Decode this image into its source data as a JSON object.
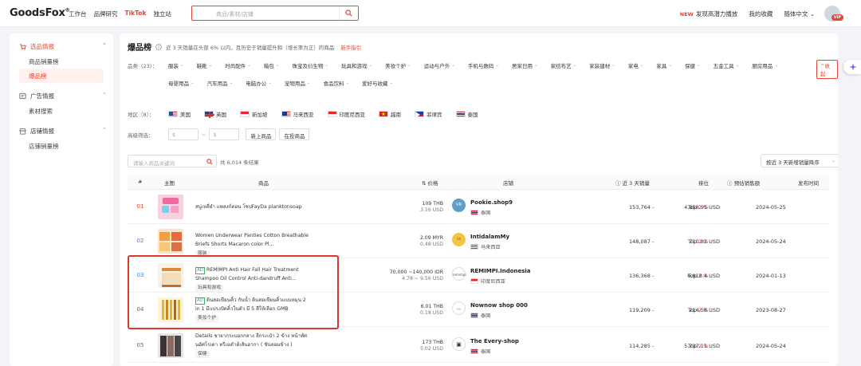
{
  "header": {
    "logo": "GoodsFox",
    "nav": [
      "工作台",
      "品牌研究",
      "TikTok",
      "独立站"
    ],
    "search_placeholder": "商品/素材/店铺",
    "new_badge": "NEW",
    "right_links": [
      "发现高潜力播放",
      "我的收藏",
      "随体中文"
    ],
    "vip": "VIP"
  },
  "sidebar": {
    "groups": [
      {
        "label": "选品情报",
        "items": [
          "商品销量榜",
          "爆品榜"
        ]
      },
      {
        "label": "广告情报",
        "items": [
          "素材搜索"
        ]
      },
      {
        "label": "店铺情报",
        "items": [
          "店铺销量榜"
        ]
      }
    ]
  },
  "main": {
    "title": "爆品榜",
    "subtitle": "近 3 天销量在头部 6% 以内，且历史于销量提升和（增长率为正）的商品",
    "guide": "新手指引",
    "category_label": "品类（23）：",
    "categories": [
      "服装",
      "鞋靴",
      "时尚配件",
      "箱包",
      "珠宝及衍生物",
      "玩具和游戏",
      "美妆个护",
      "运动与户外",
      "手机与数码",
      "居家日用",
      "家纺布艺",
      "家装建材",
      "家电",
      "家具",
      "保健",
      "五金工具",
      "厨房用品",
      "母婴用品",
      "汽车用品",
      "电脑办公",
      "宠物用品",
      "食品饮料",
      "爱好与收藏"
    ],
    "collapse_label": "^收起",
    "region_label": "地区（8）：",
    "regions": [
      "美国",
      "英国",
      "新加坡",
      "马来西亚",
      "印度尼西亚",
      "越南",
      "菲律宾",
      "泰国"
    ],
    "filter_label": "高级筛选：",
    "money_placeholder": "$",
    "money_sep": "~",
    "filter_buttons": [
      "新上商品",
      "在投商品"
    ],
    "search_placeholder": "请输入商品关键词",
    "result_count": "共 6,014 条结果",
    "sort_label": "按近 3 天新增销量降序",
    "columns": [
      "#",
      "主图",
      "商品",
      "价格",
      "店铺",
      "近 3 天销量",
      "排位",
      "预估销售额",
      "发布时间"
    ]
  },
  "rows": [
    {
      "idx": "01",
      "name": "สบู่เหลี่ยำ แพลงก์ตอน โชปFayDa planktonsoap",
      "ad": "",
      "tag": "",
      "price": "109 THB",
      "price_sub": "3.16 USD",
      "shop": "Pookie.shop9",
      "country": "泰国",
      "sales": "153,764 -",
      "rank_pre": "Top ",
      "rank_pct": "2 %",
      "rev": "4,858.95 USD",
      "date": "2024-05-25"
    },
    {
      "idx": "02",
      "name": "Women Underwear Panties Cotton Breathable Briefs Shorts Macaron color Pl...",
      "ad": "",
      "tag": "服装",
      "price": "2.09 MYR",
      "price_sub": "0.48 USD",
      "shop": "IntidalamMy",
      "country": "马来西亚",
      "sales": "148,087 -",
      "rank_pre": "Top ",
      "rank_pct": "2 %",
      "rev": "710.82 USD",
      "date": "2024-05-24"
    },
    {
      "idx": "03",
      "name": "REMIMPI Anti Hair Fall Hair Treatment Shampoo Oil Control Anti-dandruff Anti...",
      "ad": "AD",
      "tag": "玩具和游戏",
      "price": "70,000 ~140,000 IDR",
      "price_sub": "4.78 ~ 9.56 USD",
      "shop": "REMIMPI.Indonesia",
      "country": "印度尼西亚",
      "sales": "136,368 -",
      "rank_pre": "Top ",
      "rank_pct": "2 %",
      "rev": "6,818.4 USD",
      "date": "2024-01-13"
    },
    {
      "idx": "04",
      "name": "ดินสอเขียนคิ้ว กันน้ำ ดินสอเขียนคิ้วแบบหมุน 2 in 1 มีแปรงปัดคิ้วในตัว มี 5 สีให้เลือก GMB",
      "ad": "AD",
      "tag": "美妆个护",
      "price": "6.01 THB",
      "price_sub": "0.18 USD",
      "shop": "Nownow shop 000",
      "country": "泰国",
      "sales": "119,209 -",
      "rank_pre": "Top ",
      "rank_pct": "2 %",
      "rev": "214.58 USD",
      "date": "2023-08-27"
    },
    {
      "idx": "05",
      "name": "Details ชายากระบอกกลาง ลีกระเป๋า 2 ข้าง หน้าทัศนอัศโรเดา ทรีเฉดำต้เส้นอากา ( ชันลอนข้าง )",
      "ad": "",
      "tag": "保健",
      "price": "173 THB",
      "price_sub": "5.02 USD",
      "shop": "The Every-shop",
      "country": "泰国",
      "sales": "114,285 -",
      "rank_pre": "Top ",
      "rank_pct": "2 %",
      "rev": "5,737.11 USD",
      "date": "2024-05-24"
    }
  ],
  "colors": {
    "accent": "#e8432e",
    "highlight": "#e0352d"
  }
}
